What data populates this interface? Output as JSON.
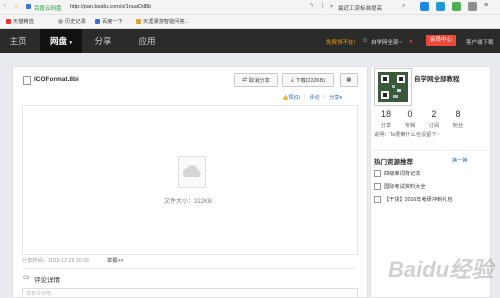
{
  "browser": {
    "site_name": "百度云网盘",
    "url": "http://pan.baidu.com/s/1nuaDd8b",
    "search_text": "最近工资标准提高",
    "bookmarks": [
      "天猫精选",
      "历史记录",
      "百度一下",
      "天涯漫游智能问答..."
    ]
  },
  "nav": {
    "items": [
      "主页",
      "网盘",
      "分享",
      "应用"
    ],
    "promo": "免费领不在!",
    "user": "自学网全部~",
    "center": "会员中心",
    "client": "客户端下载"
  },
  "file": {
    "name": "ICOFormat.8bi",
    "cancel_share": "取消分享",
    "download": "下载(222KB)",
    "like": "赞(0)",
    "comment": "评论",
    "share": "分享",
    "size_label": "文件大小：222KB",
    "share_time": "分享时间：2015-12-29 10:26",
    "report": "举报>>",
    "comments_header": "评论详情",
    "comment_placeholder": "发表评论吧..."
  },
  "profile": {
    "name": "自学网全部教程",
    "stats": [
      {
        "value": "18",
        "label": "分享"
      },
      {
        "value": "0",
        "label": "专辑"
      },
      {
        "value": "2",
        "label": "订阅"
      },
      {
        "value": "8",
        "label": "粉丝"
      }
    ],
    "bio": "说明：Ta很懒什么也没留下~"
  },
  "hot": {
    "title": "热门资源推荐",
    "refresh": "换一换",
    "items": [
      "四级单词背记法",
      "国际考试资料大全",
      "【干货】2016年考研冲刺礼包"
    ]
  },
  "watermark": "Baidu经验"
}
